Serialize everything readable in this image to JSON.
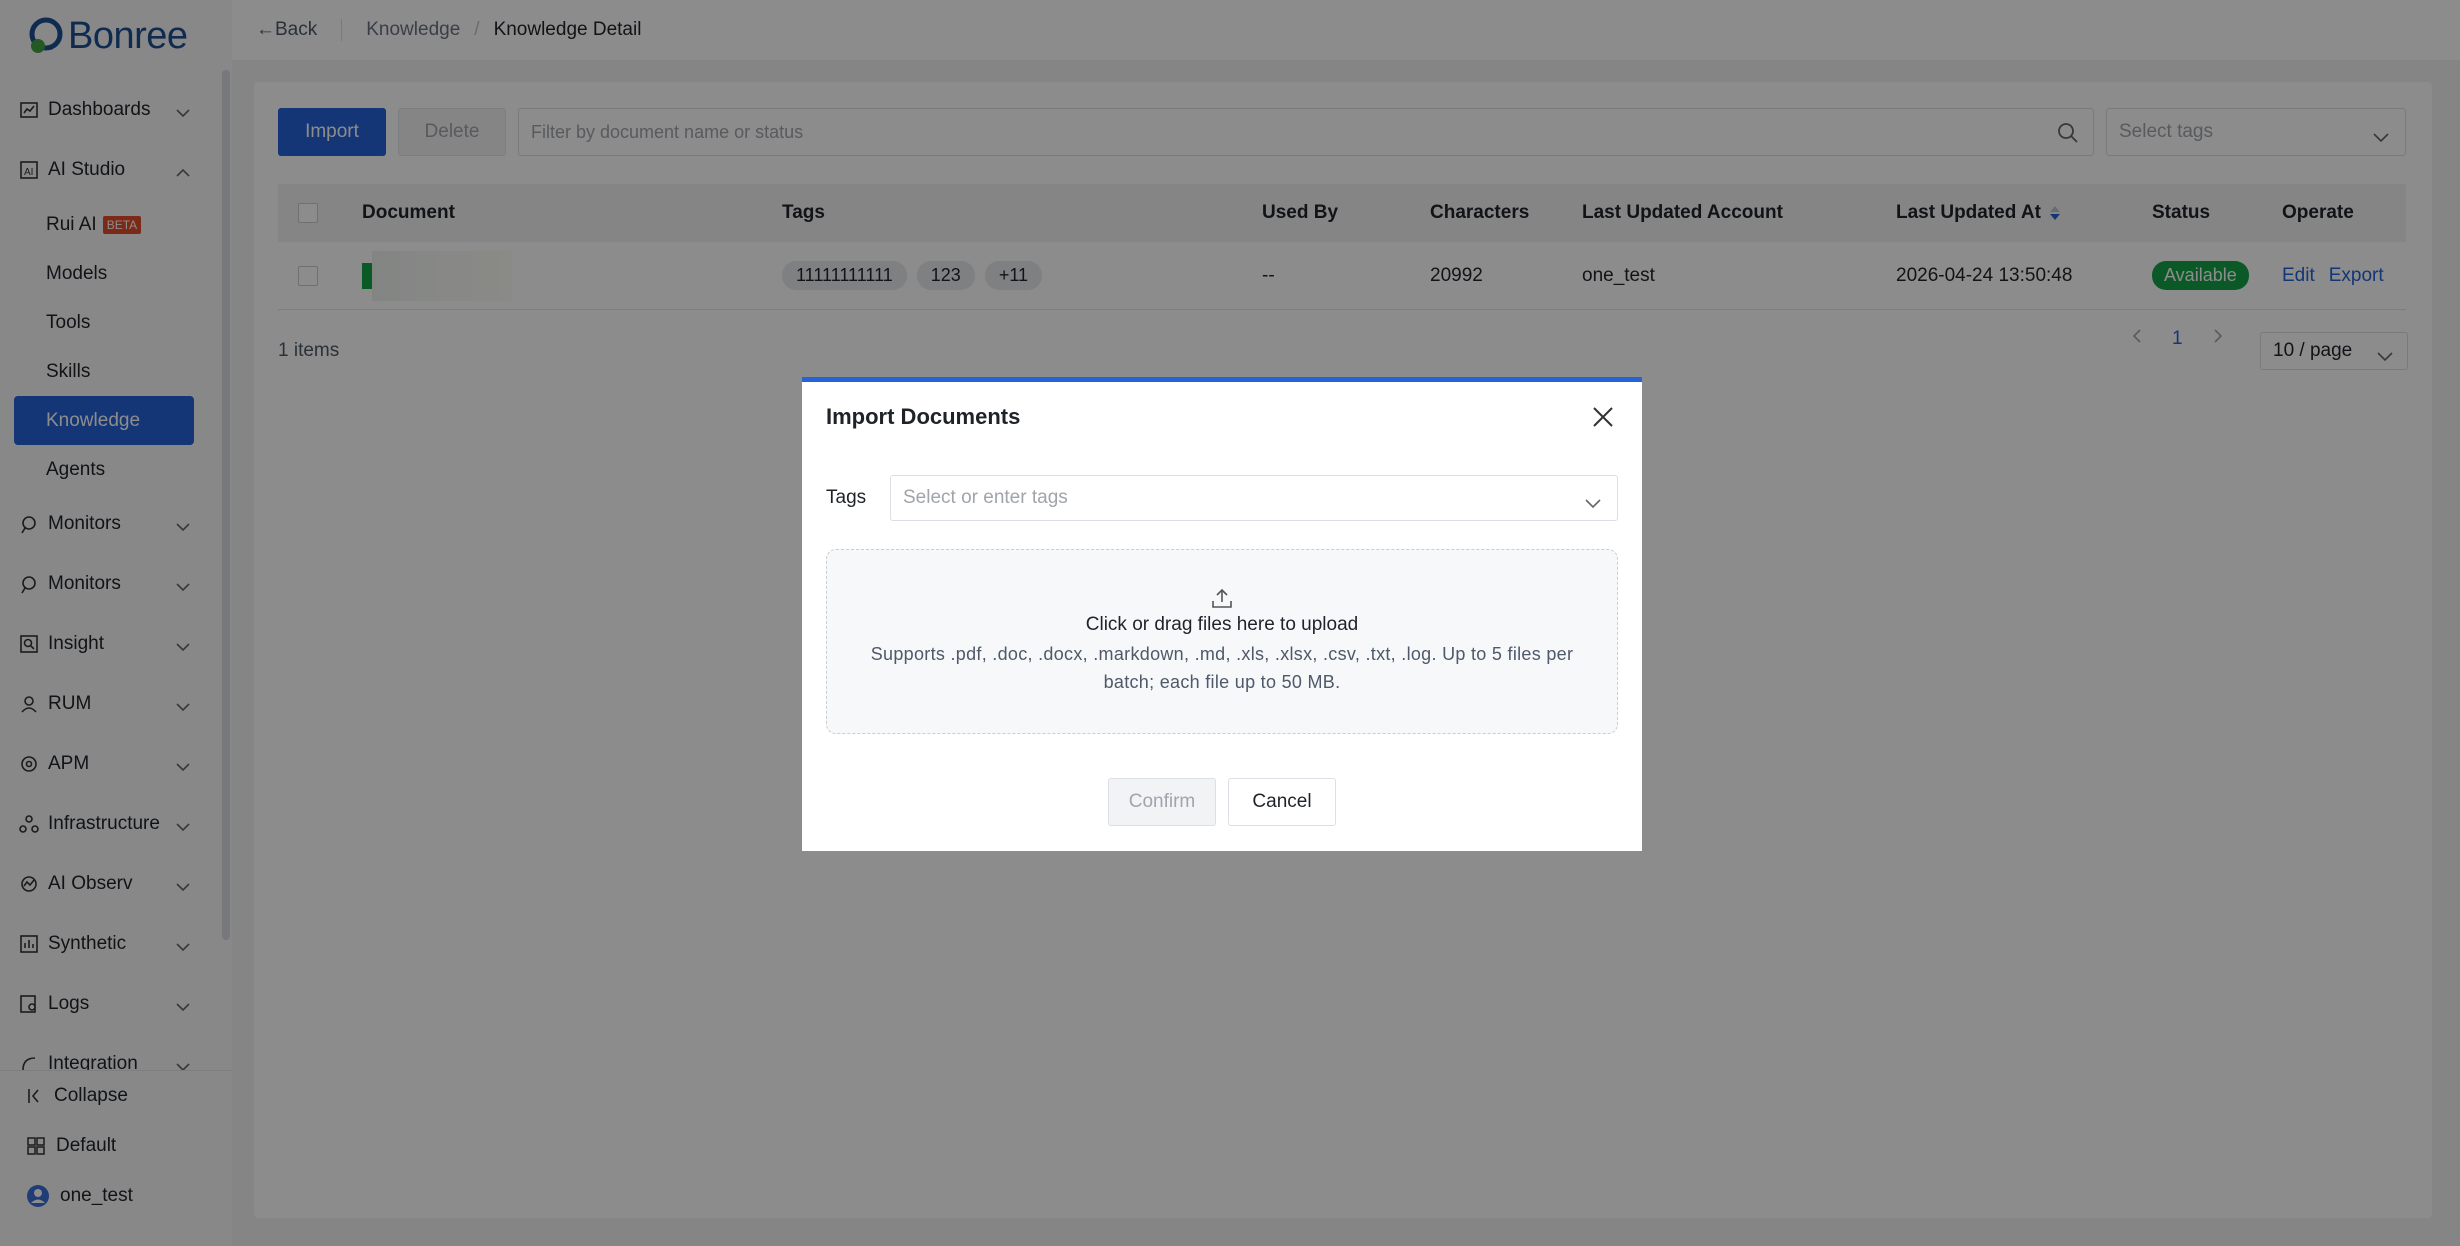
{
  "brand": {
    "name": "Bonree"
  },
  "sidebar": {
    "items": [
      {
        "label": "Dashboards",
        "icon": "dashboard-icon"
      },
      {
        "label": "AI Studio",
        "icon": "ai-studio-icon",
        "expanded": true,
        "children": [
          {
            "label": "Rui AI",
            "badge": "BETA"
          },
          {
            "label": "Models"
          },
          {
            "label": "Tools"
          },
          {
            "label": "Skills"
          },
          {
            "label": "Knowledge",
            "active": true
          },
          {
            "label": "Agents"
          }
        ]
      },
      {
        "label": "Monitors",
        "icon": "monitor-icon"
      },
      {
        "label": "Monitors",
        "icon": "monitor-icon"
      },
      {
        "label": "Insight",
        "icon": "insight-icon"
      },
      {
        "label": "RUM",
        "icon": "rum-icon"
      },
      {
        "label": "APM",
        "icon": "apm-icon"
      },
      {
        "label": "Infrastructure",
        "icon": "infrastructure-icon"
      },
      {
        "label": "AI Observ",
        "icon": "ai-observ-icon"
      },
      {
        "label": "Synthetic",
        "icon": "synthetic-icon"
      },
      {
        "label": "Logs",
        "icon": "logs-icon"
      },
      {
        "label": "Integration",
        "icon": "integration-icon"
      }
    ],
    "bottom": {
      "collapse": "Collapse",
      "default": "Default",
      "user": "one_test"
    }
  },
  "topbar": {
    "back": "Back",
    "breadcrumb": [
      "Knowledge",
      "Knowledge Detail"
    ]
  },
  "toolbar": {
    "import": "Import",
    "delete": "Delete",
    "search_placeholder": "Filter by document name or status",
    "tags_placeholder": "Select tags"
  },
  "table": {
    "headers": [
      "Document",
      "Tags",
      "Used By",
      "Characters",
      "Last Updated Account",
      "Last Updated At",
      "Status",
      "Operate"
    ],
    "rows": [
      {
        "tags": [
          "11111111111",
          "123",
          "+11"
        ],
        "used_by": "--",
        "characters": "20992",
        "account": "one_test",
        "updated_at": "2026-04-24 13:50:48",
        "status": "Available",
        "actions": [
          "Edit",
          "Export"
        ]
      }
    ]
  },
  "footer": {
    "items_count": "1 items",
    "page": "1",
    "page_size": "10 / page"
  },
  "modal": {
    "title": "Import Documents",
    "tags_label": "Tags",
    "tags_placeholder": "Select or enter tags",
    "upload_title": "Click or drag files here to upload",
    "upload_hint": "Supports .pdf, .doc, .docx, .markdown, .md, .xls, .xlsx, .csv, .txt, .log. Up to 5 files per batch; each file up to 50 MB.",
    "confirm": "Confirm",
    "cancel": "Cancel"
  },
  "colors": {
    "accent": "#2563d9",
    "status_available": "#16a34a",
    "beta_badge": "#e24b2a"
  }
}
